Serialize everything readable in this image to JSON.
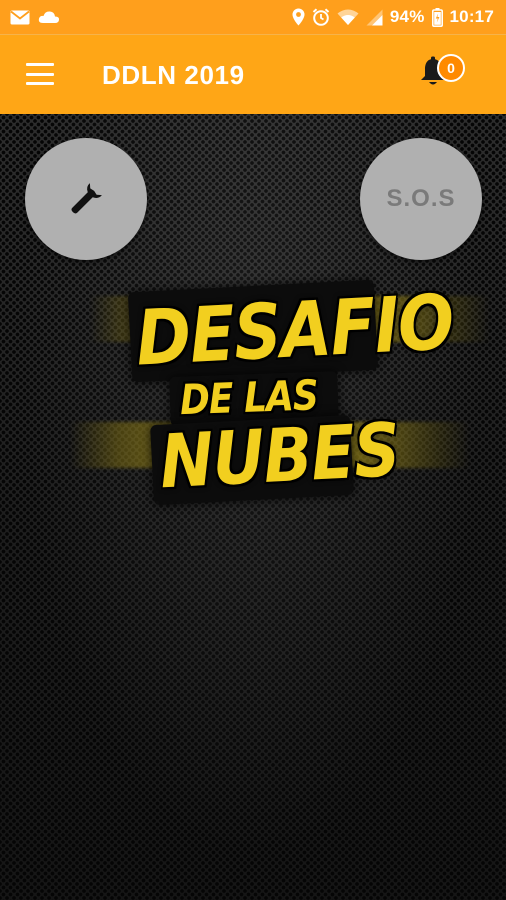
{
  "status_bar": {
    "battery": "94%",
    "time": "10:17",
    "icons": [
      "mail-icon",
      "cloud-icon",
      "location-icon",
      "alarm-icon",
      "wifi-icon",
      "signal-icon",
      "battery-icon"
    ]
  },
  "app_bar": {
    "title": "DDLN 2019",
    "menu_icon": "hamburger-icon",
    "notification_icon": "bell-icon",
    "notification_count": "0"
  },
  "main": {
    "tools_icon": "wrench-icon",
    "sos_label": "S.O.S",
    "logo_lines": [
      "DESAFIO",
      "DE LAS",
      "NUBES"
    ]
  },
  "colors": {
    "accent": "#ffa616",
    "logo_yellow": "#f2cf1f",
    "button_gray": "#b0b0b0"
  }
}
